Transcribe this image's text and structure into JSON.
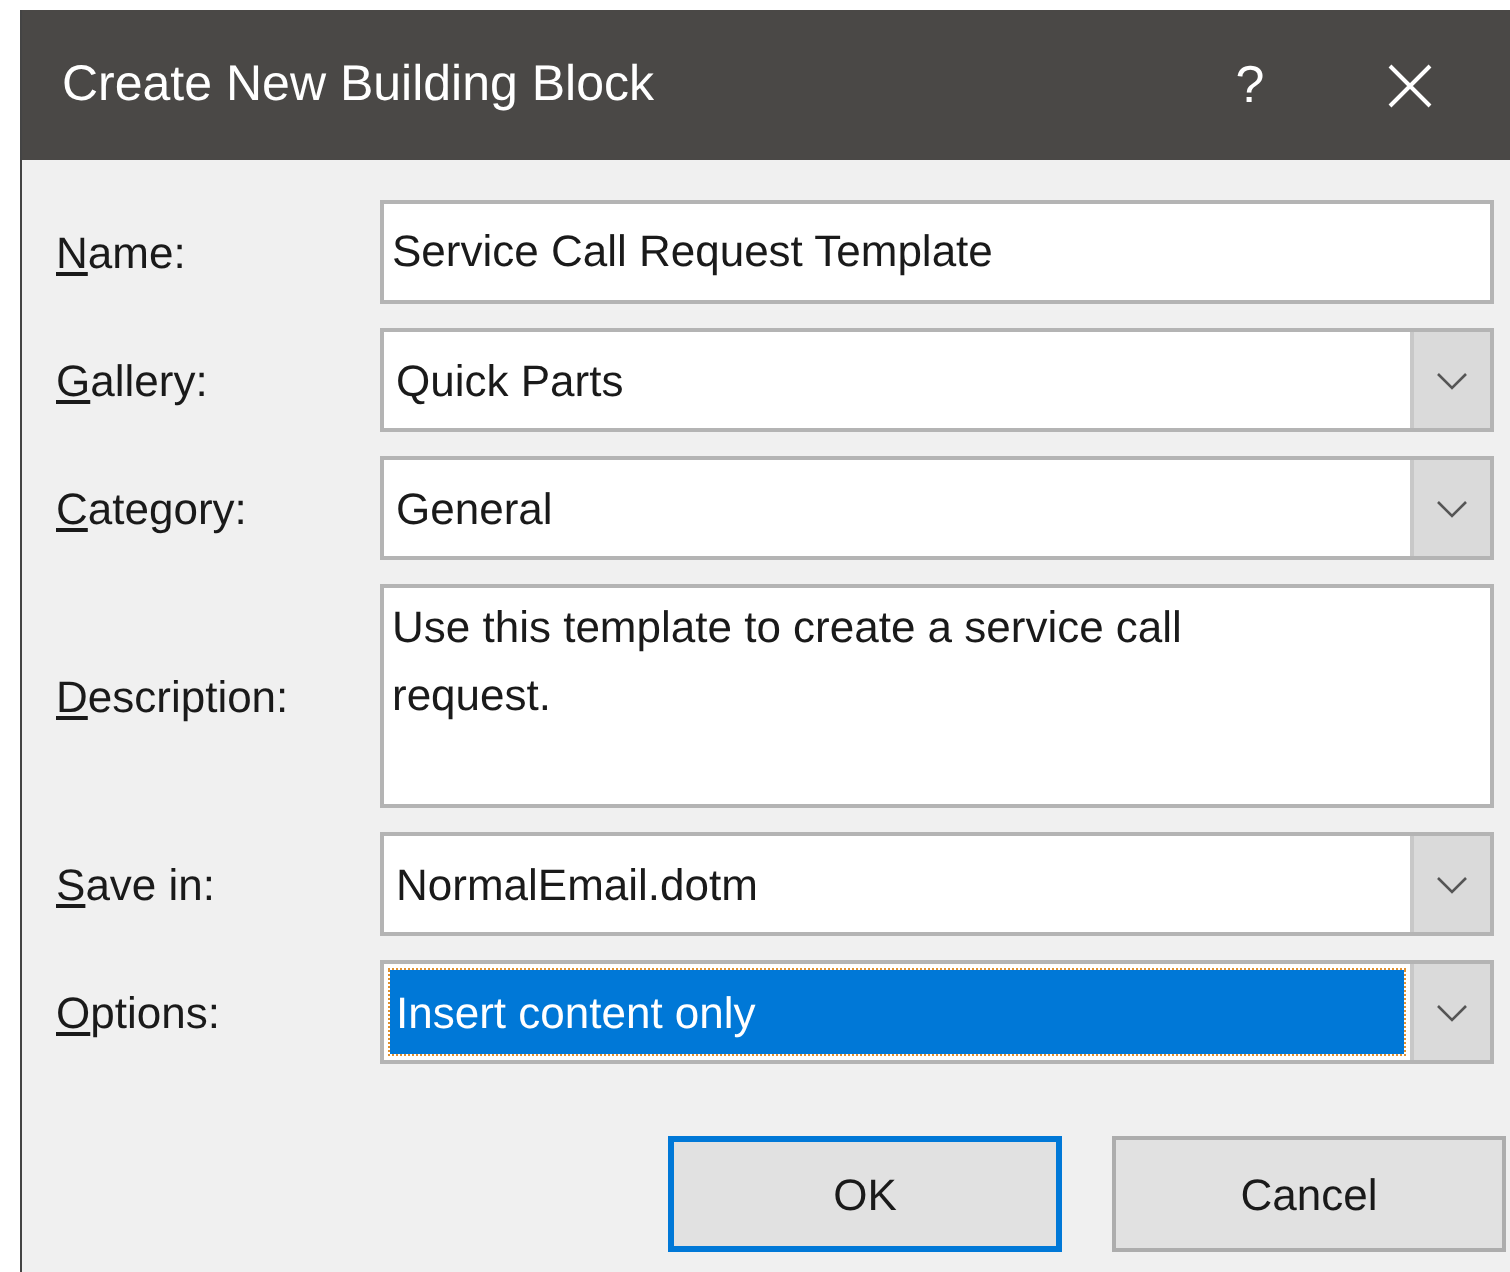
{
  "window": {
    "title": "Create New Building Block",
    "help": "?"
  },
  "fields": [
    {
      "kind": "text",
      "label": "Name:",
      "mnemonic": true,
      "value": "Service Call Request Template",
      "highlighted": false
    },
    {
      "kind": "dropdown",
      "label": "Gallery:",
      "mnemonic": true,
      "value": "Quick Parts",
      "highlighted": false
    },
    {
      "kind": "dropdown",
      "label": "Category:",
      "mnemonic": true,
      "value": "General",
      "highlighted": false
    },
    {
      "kind": "textarea",
      "label": "Description:",
      "mnemonic": true,
      "value": "Use this template to create a service call request.",
      "highlighted": false
    },
    {
      "kind": "dropdown",
      "label": "Save in:",
      "mnemonic": true,
      "value": "NormalEmail.dotm",
      "highlighted": false
    },
    {
      "kind": "dropdown",
      "label": "Options:",
      "mnemonic": true,
      "value": "Insert content only",
      "highlighted": true
    }
  ],
  "buttons": [
    {
      "label": "OK",
      "default": true
    },
    {
      "label": "Cancel",
      "default": false
    }
  ]
}
